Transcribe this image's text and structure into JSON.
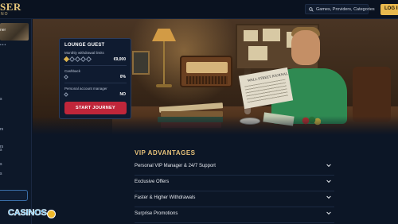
{
  "header": {
    "logo": "SER",
    "logo_sub": "NO",
    "search_placeholder": "Games, Providers, Categories",
    "login_label": "LOG IN"
  },
  "sidebar": {
    "thumb_label": "ner",
    "dots": "•••",
    "items": [
      "rs",
      "rs",
      "s",
      "s",
      "s",
      "s"
    ]
  },
  "vip_card": {
    "title": "LOUNGE GUEST",
    "rows": [
      {
        "label": "Monthly withdrawal limits",
        "value": "€9,000"
      },
      {
        "label": "Cashback",
        "value": "0%"
      },
      {
        "label": "Personal account manager",
        "value": "NO"
      }
    ],
    "level": 1,
    "levels_total": 5,
    "button_label": "START JOURNEY"
  },
  "hero": {
    "newspaper_title": "WALL STREET JOURNAL"
  },
  "advantages": {
    "title": "VIP ADVANTAGES",
    "items": [
      "Personal VIP Manager & 24/7 Support",
      "Exclusive Offers",
      "Faster & Higher Withdrawals",
      "Surprise Promotions"
    ]
  },
  "watermark": {
    "text": "CASINOS"
  },
  "colors": {
    "accent_gold": "#e7c27a",
    "cta_red": "#c0263a",
    "login_yellow": "#e9b94e",
    "bg": "#0c1626"
  }
}
